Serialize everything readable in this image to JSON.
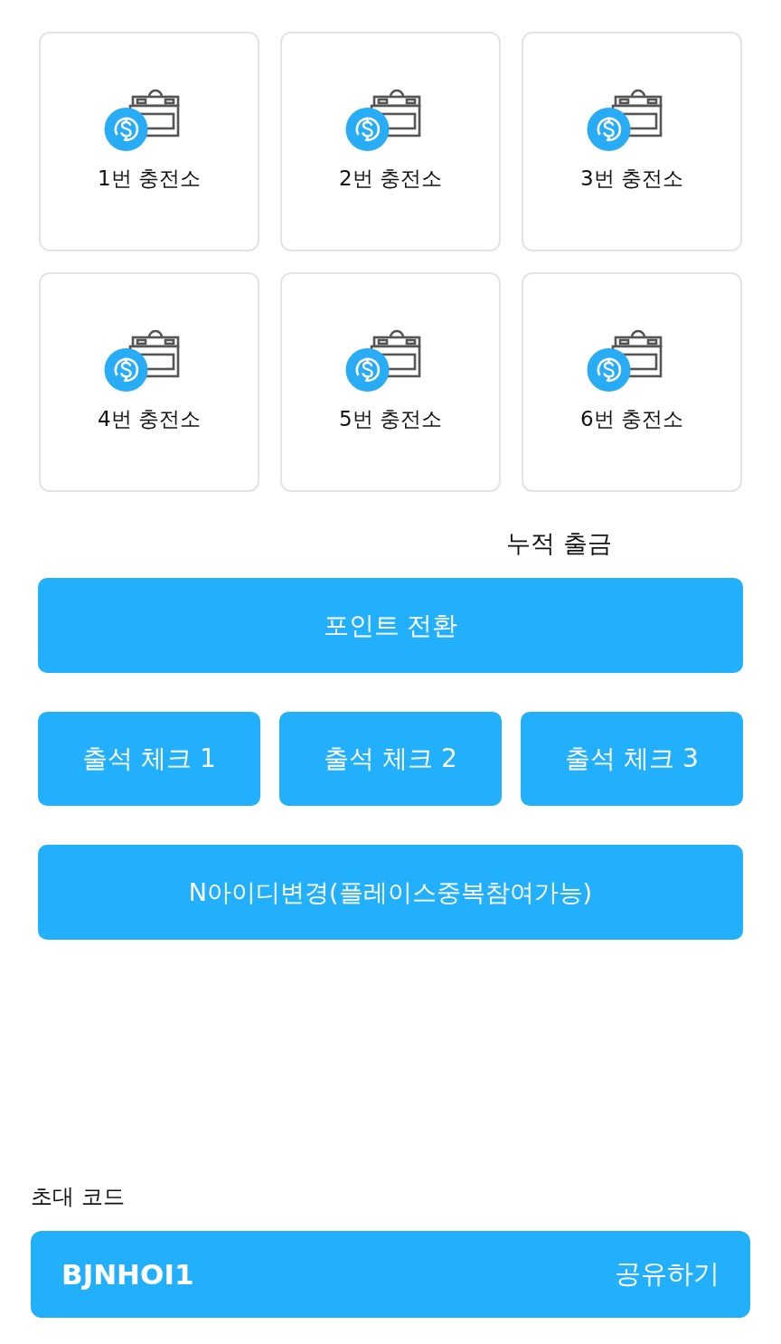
{
  "stations": [
    {
      "label": "1번 충전소"
    },
    {
      "label": "2번 충전소"
    },
    {
      "label": "3번 충전소"
    },
    {
      "label": "4번 충전소"
    },
    {
      "label": "5번 충전소"
    },
    {
      "label": "6번 충전소"
    }
  ],
  "withdrawal": {
    "label": "누적 출금"
  },
  "actions": {
    "convert_button": "포인트 전환",
    "attendance_buttons": [
      "출석 체크 1",
      "출석 체크 2",
      "출석 체크 3"
    ],
    "change_id_button": "N아이디변경(플레이스중복참여가능)"
  },
  "invite": {
    "label": "초대 코드",
    "code": "BJNHOI1",
    "share_button": "공유하기"
  }
}
